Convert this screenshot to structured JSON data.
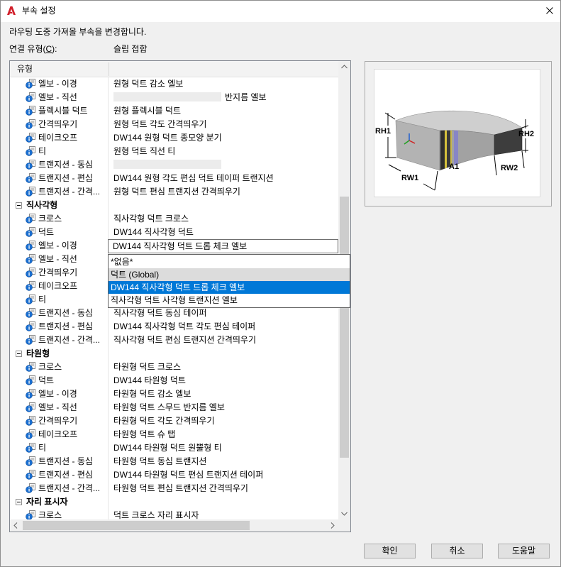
{
  "window": {
    "title": "부속 설정"
  },
  "description": "라우팅 도중 가져올 부속을 변경합니다.",
  "connection_type": {
    "label_prefix": "연결 유형(",
    "label_mnemonic": "C",
    "label_suffix": "):",
    "value": "슬립 접합"
  },
  "grid": {
    "header": "유형",
    "rows": [
      {
        "type": "item",
        "label": "엘보 - 이경",
        "value": "원형 덕트 감소 엘보"
      },
      {
        "type": "item",
        "label": "엘보 - 직선",
        "value": "반지름 엘보",
        "redacted": true
      },
      {
        "type": "item",
        "label": "플렉시블 덕트",
        "value": "원형 플렉시블 덕트"
      },
      {
        "type": "item",
        "label": "간격띄우기",
        "value": "원형 덕트 각도 간격띄우기"
      },
      {
        "type": "item",
        "label": "테이크오프",
        "value": "DW144 원형 덕트 종모양 분기"
      },
      {
        "type": "item",
        "label": "티",
        "value": "원형 덕트 직선 티"
      },
      {
        "type": "item",
        "label": "트랜지션 - 동심",
        "value": "",
        "redacted": true
      },
      {
        "type": "item",
        "label": "트랜지션 - 편심",
        "value": "DW144 원형 각도 편심 덕트 테이퍼 트랜지션"
      },
      {
        "type": "item",
        "label": "트랜지션 - 간격...",
        "value": "원형 덕트 편심 트랜지션 간격띄우기"
      },
      {
        "type": "group",
        "label": "직사각형",
        "expanded": true
      },
      {
        "type": "item",
        "label": "크로스",
        "value": "직사각형 덕트 크로스"
      },
      {
        "type": "item",
        "label": "덕트",
        "value": "DW144 직사각형 덕트"
      },
      {
        "type": "item",
        "label": "엘보 - 이경",
        "value": "DW144 직사각형 덕트 드롭 체크 엘보",
        "editing": true
      },
      {
        "type": "item",
        "label": "엘보 - 직선",
        "value": ""
      },
      {
        "type": "item",
        "label": "간격띄우기",
        "value": ""
      },
      {
        "type": "item",
        "label": "테이크오프",
        "value": ""
      },
      {
        "type": "item",
        "label": "티",
        "value": ""
      },
      {
        "type": "item",
        "label": "트랜지션 - 동심",
        "value": "직사각형 덕트 동심 테이퍼"
      },
      {
        "type": "item",
        "label": "트랜지션 - 편심",
        "value": "DW144 직사각형 덕트 각도 편심 테이퍼"
      },
      {
        "type": "item",
        "label": "트랜지션 - 간격...",
        "value": "직사각형 덕트 편심 트랜지션 간격띄우기"
      },
      {
        "type": "group",
        "label": "타원형",
        "expanded": true
      },
      {
        "type": "item",
        "label": "크로스",
        "value": "타원형 덕트 크로스"
      },
      {
        "type": "item",
        "label": "덕트",
        "value": "DW144 타원형 덕트"
      },
      {
        "type": "item",
        "label": "엘보 - 이경",
        "value": "타원형 덕트 감소 엘보"
      },
      {
        "type": "item",
        "label": "엘보 - 직선",
        "value": "타원형 덕트 스무드 반지름 엘보"
      },
      {
        "type": "item",
        "label": "간격띄우기",
        "value": "타원형 덕트 각도 간격띄우기"
      },
      {
        "type": "item",
        "label": "테이크오프",
        "value": "타원형 덕트 슈 탭"
      },
      {
        "type": "item",
        "label": "티",
        "value": "DW144 타원형 덕트 원뿔형 티"
      },
      {
        "type": "item",
        "label": "트랜지션 - 동심",
        "value": "타원형 덕트 동심 트랜지션"
      },
      {
        "type": "item",
        "label": "트랜지션 - 편심",
        "value": "DW144 타원형 덕트 편심 트랜지션 테이퍼"
      },
      {
        "type": "item",
        "label": "트랜지션 - 간격...",
        "value": "타원형 덕트 편심 트랜지션 간격띄우기"
      },
      {
        "type": "group",
        "label": "자리 표시자",
        "expanded": true
      },
      {
        "type": "item",
        "label": "크로스",
        "value": "덕트 크로스 자리 표시자"
      }
    ]
  },
  "dropdown": {
    "options": [
      "*없음*",
      "덕트 (Global)",
      "DW144 직사각형 덕트 드롭 체크 엘보",
      "직사각형 덕트 사각형 트랜지션 엘보"
    ],
    "hover_index": 1,
    "selected_index": 2
  },
  "preview": {
    "labels": {
      "rh1": "RH1",
      "rh2": "RH2",
      "rw1": "RW1",
      "rw2": "RW2",
      "a1": "A1"
    }
  },
  "buttons": {
    "ok": "확인",
    "cancel": "취소",
    "help": "도움말"
  },
  "icons": {
    "app": "autocad-logo-icon",
    "close": "close-icon",
    "fitting": "fitting-info-icon",
    "group_toggle": "collapse-toggle-icon"
  },
  "colors": {
    "selection_bg": "#0078d7",
    "selection_text": "#ffffff",
    "hover_bg": "#dcdcdc",
    "info_icon_blue": "#1a6fd1",
    "app_icon_red": "#d11f2a"
  }
}
